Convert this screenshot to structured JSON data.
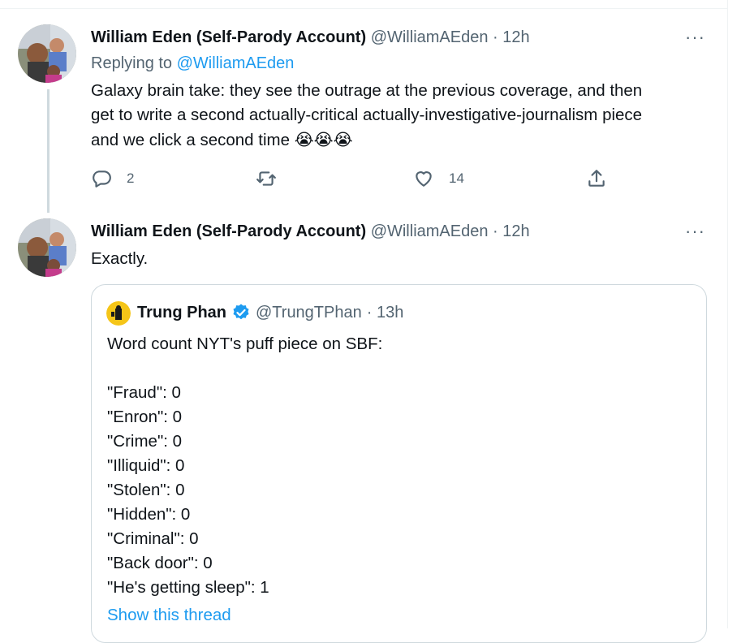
{
  "tweet1": {
    "author_name": "William Eden (Self-Parody Account)",
    "handle": "@WilliamAEden",
    "time": "· 12h",
    "more": "···",
    "replying_prefix": "Replying to",
    "replying_handle": "@WilliamAEden",
    "text_line1": "Galaxy brain take: they see the outrage at the previous coverage, and then",
    "text_line2": "get to write a second actually-critical actually-investigative-journalism piece",
    "text_line3": "and we click a second time",
    "text_emoji": "😭😭😭",
    "reply_count": "2",
    "like_count": "14"
  },
  "tweet2": {
    "author_name": "William Eden (Self-Parody Account)",
    "handle": "@WilliamAEden",
    "time": "· 12h",
    "more": "···",
    "text": "Exactly."
  },
  "quote": {
    "author_name": "Trung Phan",
    "handle": "@TrungTPhan",
    "time": "· 13h",
    "lines": [
      "Word count NYT's puff piece on SBF:",
      "",
      "\"Fraud\": 0",
      "\"Enron\": 0",
      "\"Crime\": 0",
      "\"Illiquid\": 0",
      "\"Stolen\": 0",
      "\"Hidden\": 0",
      "\"Criminal\": 0",
      "\"Back door\": 0",
      "\"He's getting sleep\": 1"
    ],
    "show_thread": "Show this thread"
  },
  "icons": {
    "reply": "reply-bubble-icon",
    "retweet": "retweet-icon",
    "like": "heart-icon",
    "share": "share-upload-icon",
    "verified": "verified-badge-icon",
    "more": "more-dots-icon"
  },
  "colors": {
    "link": "#1d9bf0",
    "muted": "#536471",
    "text": "#0f1419",
    "border": "#cfd9de"
  }
}
